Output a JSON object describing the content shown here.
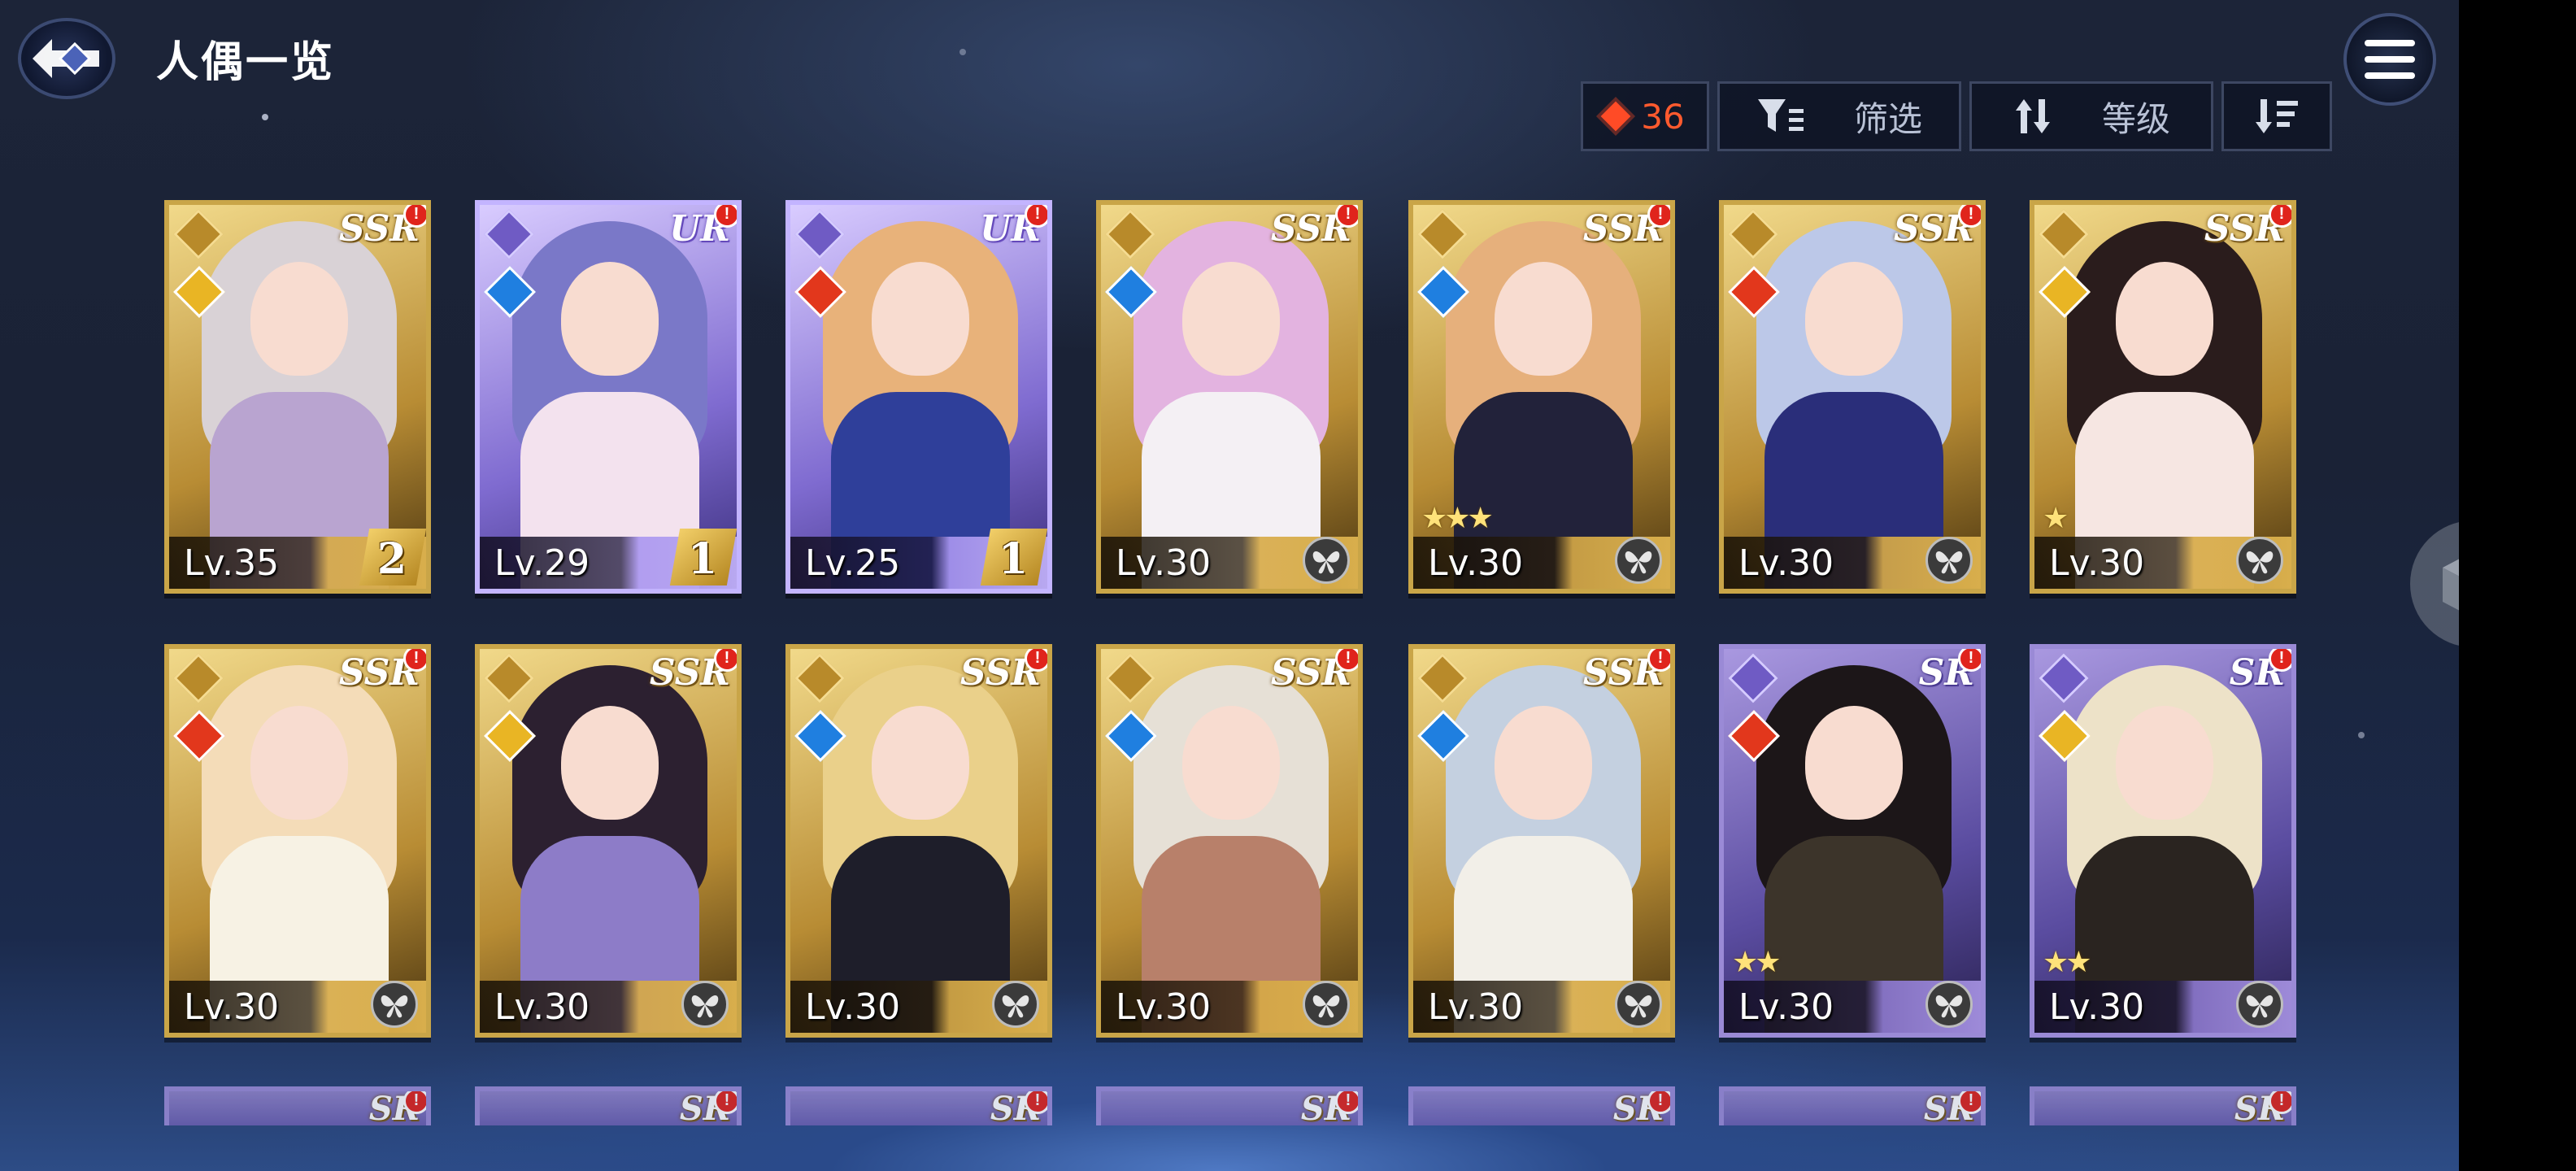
{
  "header": {
    "title": "人偶一览",
    "currency_value": "36",
    "filter_label": "筛选",
    "sort_label": "等级"
  },
  "colors": {
    "gold_frame": "#c9a548",
    "ur_frame": "#c3b4ff",
    "sr_frame": "#9a8ad6",
    "alert_red": "#e0241c",
    "currency_orange": "#ff5a2e"
  },
  "cards": [
    {
      "rarity": "SSR",
      "level": "Lv.35",
      "bond": "2",
      "element": "light",
      "stars": "",
      "hair": "#d9d2d6",
      "outfit": "#b9a4d0"
    },
    {
      "rarity": "UR",
      "level": "Lv.29",
      "bond": "1",
      "element": "water",
      "stars": "",
      "hair": "#7a78c8",
      "outfit": "#f3e2ee"
    },
    {
      "rarity": "UR",
      "level": "Lv.25",
      "bond": "1",
      "element": "fire",
      "stars": "",
      "hair": "#e8b27a",
      "outfit": "#2f3f9a"
    },
    {
      "rarity": "SSR",
      "level": "Lv.30",
      "bond": "",
      "element": "water",
      "stars": "",
      "hair": "#e3b3e0",
      "outfit": "#f4f0f4"
    },
    {
      "rarity": "SSR",
      "level": "Lv.30",
      "bond": "",
      "element": "water",
      "stars": "★★★",
      "hair": "#e6b07c",
      "outfit": "#22223a"
    },
    {
      "rarity": "SSR",
      "level": "Lv.30",
      "bond": "",
      "element": "fire",
      "stars": "",
      "hair": "#bcc8e8",
      "outfit": "#2a2e7a"
    },
    {
      "rarity": "SSR",
      "level": "Lv.30",
      "bond": "",
      "element": "light",
      "stars": "★",
      "hair": "#2a1c1c",
      "outfit": "#f6e6e2"
    },
    {
      "rarity": "SSR",
      "level": "Lv.30",
      "bond": "",
      "element": "fire",
      "stars": "",
      "hair": "#f4dcb8",
      "outfit": "#f7f2e4"
    },
    {
      "rarity": "SSR",
      "level": "Lv.30",
      "bond": "",
      "element": "light",
      "stars": "",
      "hair": "#2c2030",
      "outfit": "#8d7cc8"
    },
    {
      "rarity": "SSR",
      "level": "Lv.30",
      "bond": "",
      "element": "water",
      "stars": "",
      "hair": "#ead08a",
      "outfit": "#1e1e2a"
    },
    {
      "rarity": "SSR",
      "level": "Lv.30",
      "bond": "",
      "element": "water",
      "stars": "",
      "hair": "#e6e0d6",
      "outfit": "#b8806a"
    },
    {
      "rarity": "SSR",
      "level": "Lv.30",
      "bond": "",
      "element": "water",
      "stars": "",
      "hair": "#c4d0e0",
      "outfit": "#f2efe8"
    },
    {
      "rarity": "SR",
      "level": "Lv.30",
      "bond": "",
      "element": "fire",
      "stars": "★★",
      "hair": "#1c1618",
      "outfit": "#3c342a"
    },
    {
      "rarity": "SR",
      "level": "Lv.30",
      "bond": "",
      "element": "light",
      "stars": "★★",
      "hair": "#ede2c8",
      "outfit": "#2a2420"
    }
  ],
  "peek_cards": [
    {
      "rarity": "SR"
    },
    {
      "rarity": "SR"
    },
    {
      "rarity": "SR"
    },
    {
      "rarity": "SR"
    },
    {
      "rarity": "SR"
    },
    {
      "rarity": "SR"
    },
    {
      "rarity": "SR"
    }
  ]
}
